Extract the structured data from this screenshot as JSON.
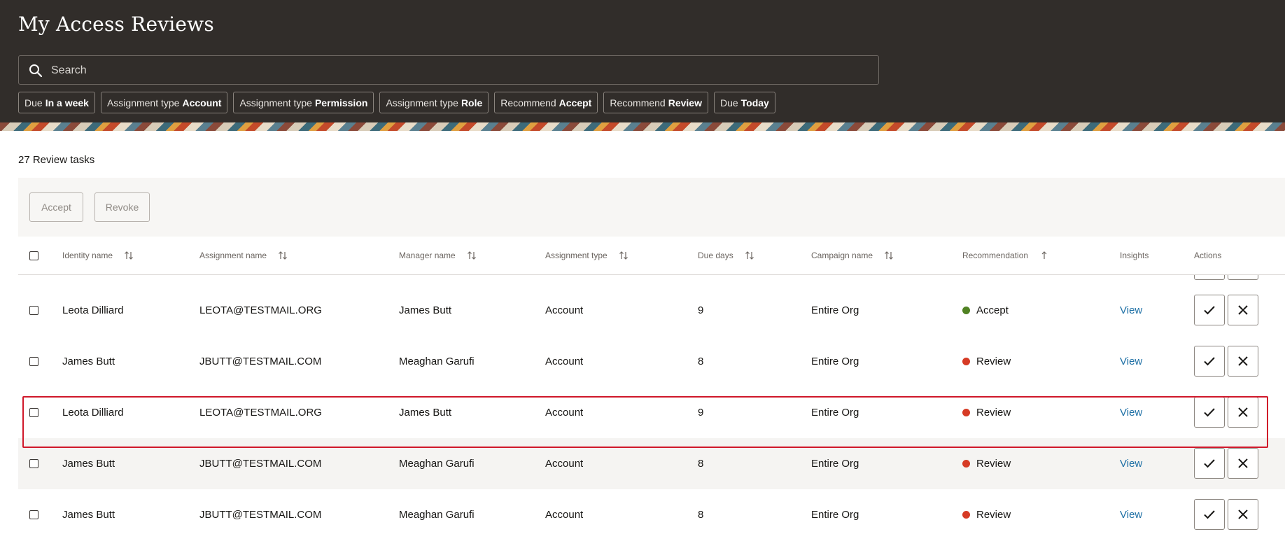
{
  "header": {
    "title": "My Access Reviews",
    "search_placeholder": "Search",
    "filters": [
      {
        "prefix": "Due",
        "value": "In a week"
      },
      {
        "prefix": "Assignment type",
        "value": "Account"
      },
      {
        "prefix": "Assignment type",
        "value": "Permission"
      },
      {
        "prefix": "Assignment type",
        "value": "Role"
      },
      {
        "prefix": "Recommend",
        "value": "Accept"
      },
      {
        "prefix": "Recommend",
        "value": "Review"
      },
      {
        "prefix": "Due",
        "value": "Today"
      }
    ]
  },
  "summary": {
    "count_label": "27 Review tasks"
  },
  "toolbar": {
    "accept_label": "Accept",
    "revoke_label": "Revoke"
  },
  "table": {
    "columns": {
      "identity": "Identity name",
      "assignment": "Assignment name",
      "manager": "Manager name",
      "type": "Assignment type",
      "due": "Due days",
      "campaign": "Campaign name",
      "recommendation": "Recommendation",
      "insights": "Insights",
      "actions": "Actions"
    },
    "rows": [
      {
        "identity": "Leota Dilliard",
        "assignment": "LEOTA@TESTMAIL.ORG",
        "manager": "James Butt",
        "type": "Account",
        "due": "9",
        "campaign": "Entire Org",
        "recommendation": "Accept",
        "insights": "View"
      },
      {
        "identity": "James Butt",
        "assignment": "JBUTT@TESTMAIL.COM",
        "manager": "Meaghan Garufi",
        "type": "Account",
        "due": "8",
        "campaign": "Entire Org",
        "recommendation": "Review",
        "insights": "View"
      },
      {
        "identity": "Leota Dilliard",
        "assignment": "LEOTA@TESTMAIL.ORG",
        "manager": "James Butt",
        "type": "Account",
        "due": "9",
        "campaign": "Entire Org",
        "recommendation": "Review",
        "insights": "View"
      },
      {
        "identity": "James Butt",
        "assignment": "JBUTT@TESTMAIL.COM",
        "manager": "Meaghan Garufi",
        "type": "Account",
        "due": "8",
        "campaign": "Entire Org",
        "recommendation": "Review",
        "insights": "View"
      },
      {
        "identity": "James Butt",
        "assignment": "JBUTT@TESTMAIL.COM",
        "manager": "Meaghan Garufi",
        "type": "Account",
        "due": "8",
        "campaign": "Entire Org",
        "recommendation": "Review",
        "insights": "View"
      }
    ]
  },
  "colors": {
    "header_bg": "#312d2a",
    "accept_dot": "#508223",
    "review_dot": "#d63b25",
    "link": "#1d6fa5",
    "highlight": "#d0182a"
  },
  "icons": {
    "search": "search-icon",
    "sort": "sort-icon",
    "sort_ascending": "sort-ascending-icon",
    "accept_action": "checkmark-icon",
    "revoke_action": "close-icon"
  }
}
